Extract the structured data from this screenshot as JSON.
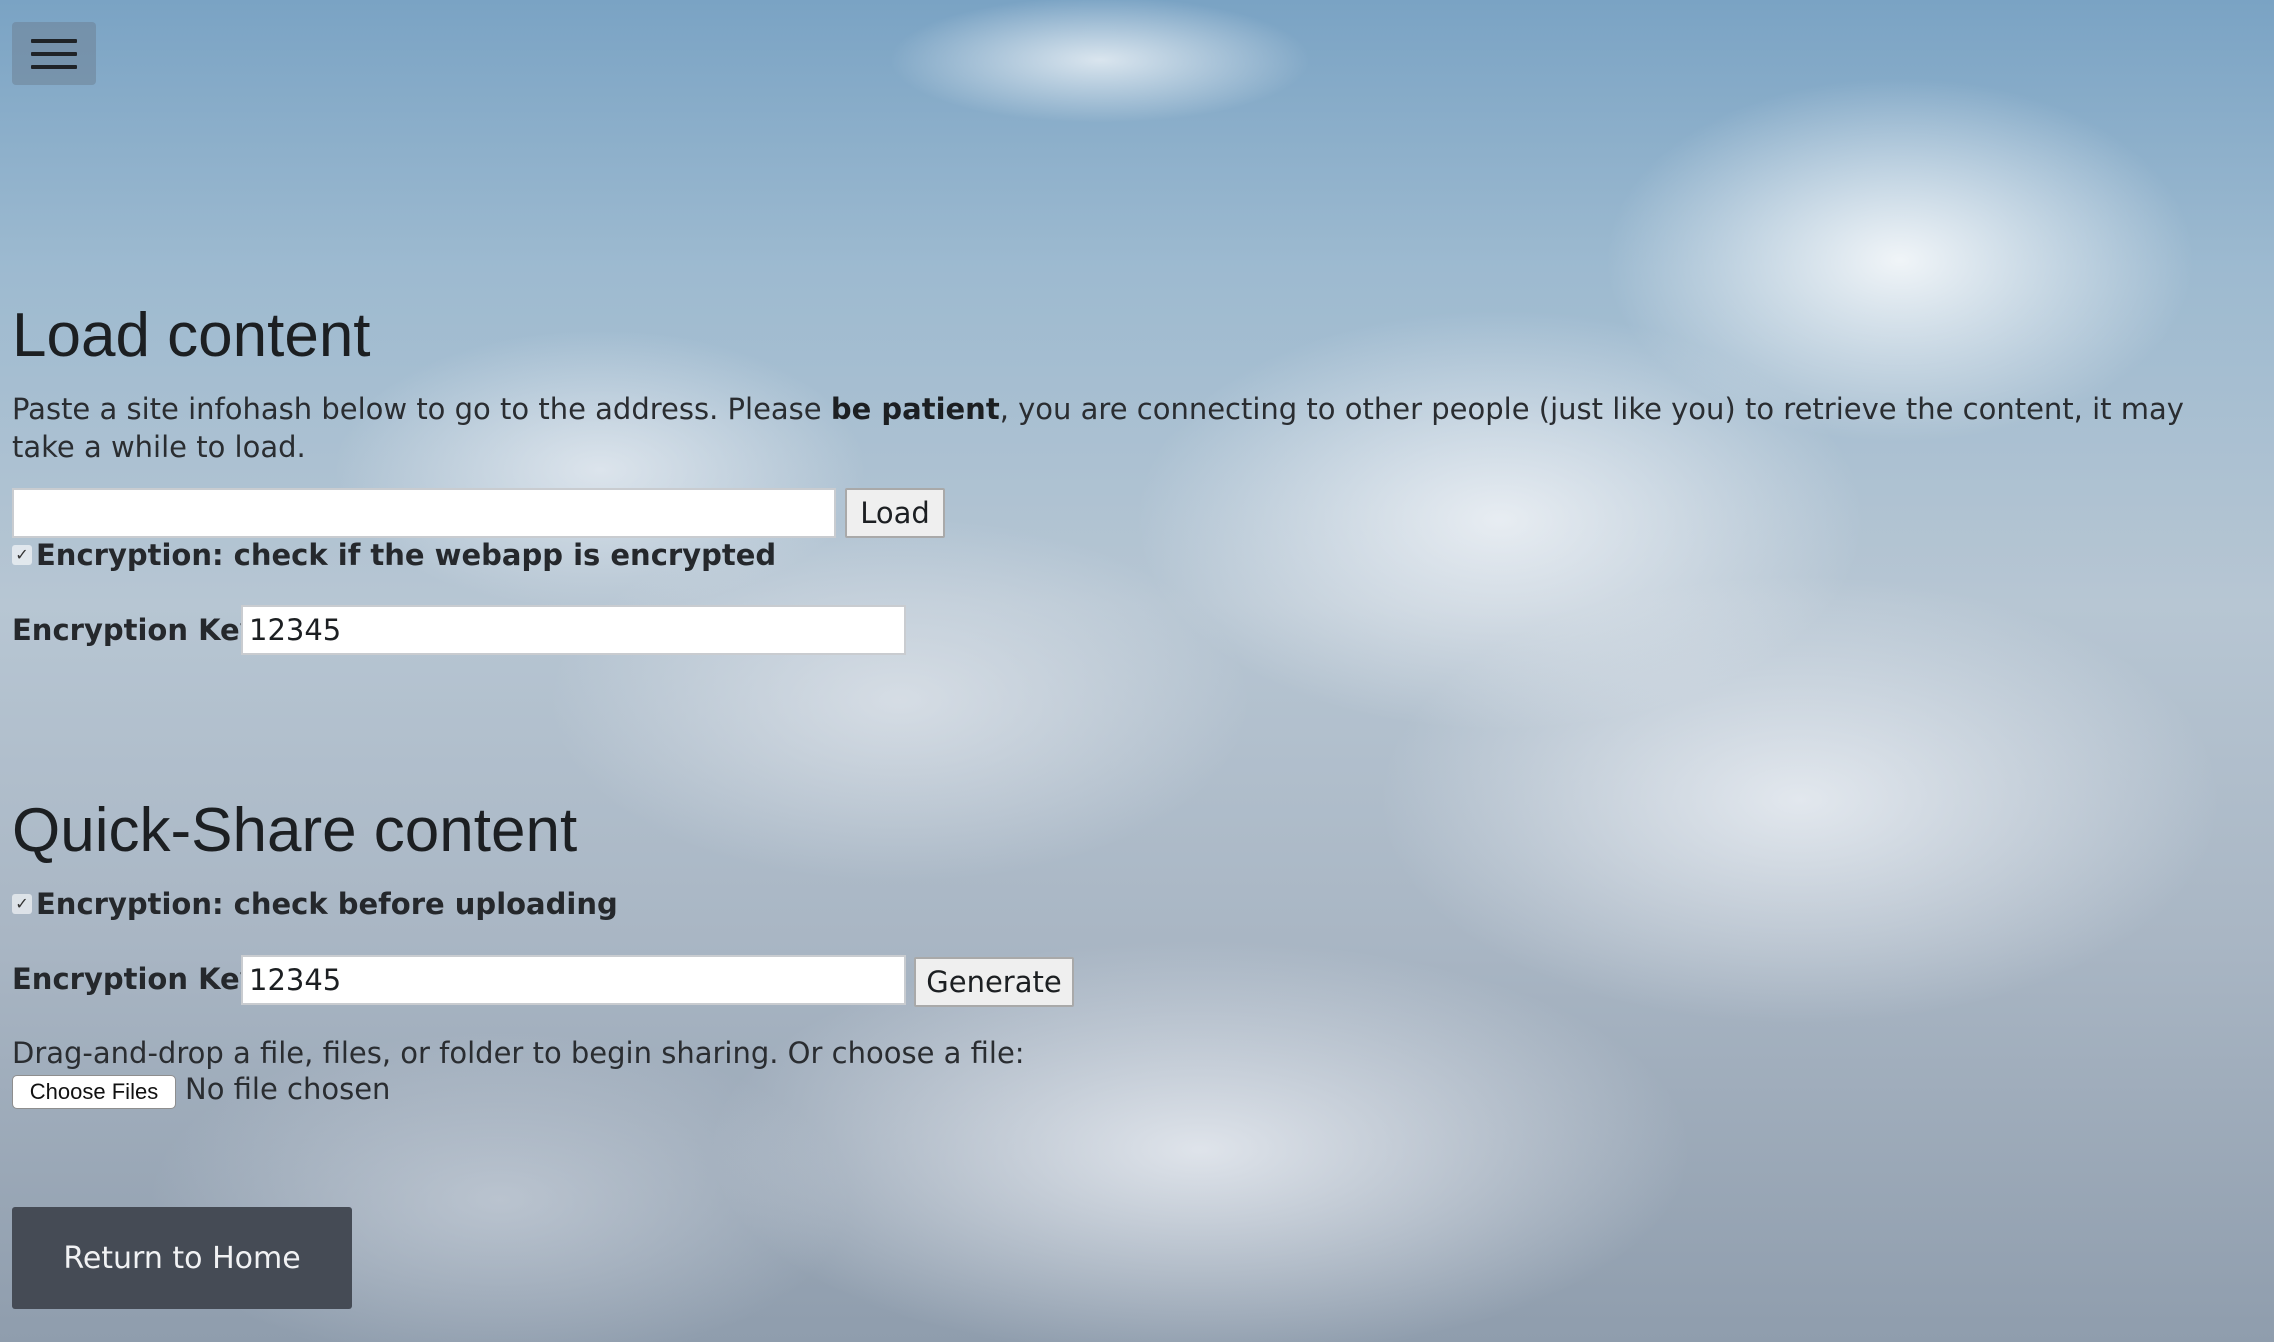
{
  "menu": {
    "icon": "hamburger-menu-icon"
  },
  "load": {
    "title": "Load content",
    "description_before": "Paste a site infohash below to go to the address. Please ",
    "description_bold": "be patient",
    "description_after": ", you are connecting to other people (just like you) to retrieve the content, it may take a while to load.",
    "infohash_value": "",
    "load_button": "Load",
    "encryption_check_label": "Encryption: check if the webapp is encrypted",
    "encryption_checked": true,
    "key_label": "Encryption Key:",
    "key_value": "12345"
  },
  "share": {
    "title": "Quick-Share content",
    "encryption_check_label": "Encryption: check before uploading",
    "encryption_checked": true,
    "key_label": "Encryption Key:",
    "key_value": "12345",
    "generate_button": "Generate",
    "drop_hint": "Drag-and-drop a file, files, or folder to begin sharing. Or choose a file:",
    "choose_files_button": "Choose Files",
    "file_status": "No file chosen"
  },
  "footer": {
    "home_button": "Return to Home"
  }
}
